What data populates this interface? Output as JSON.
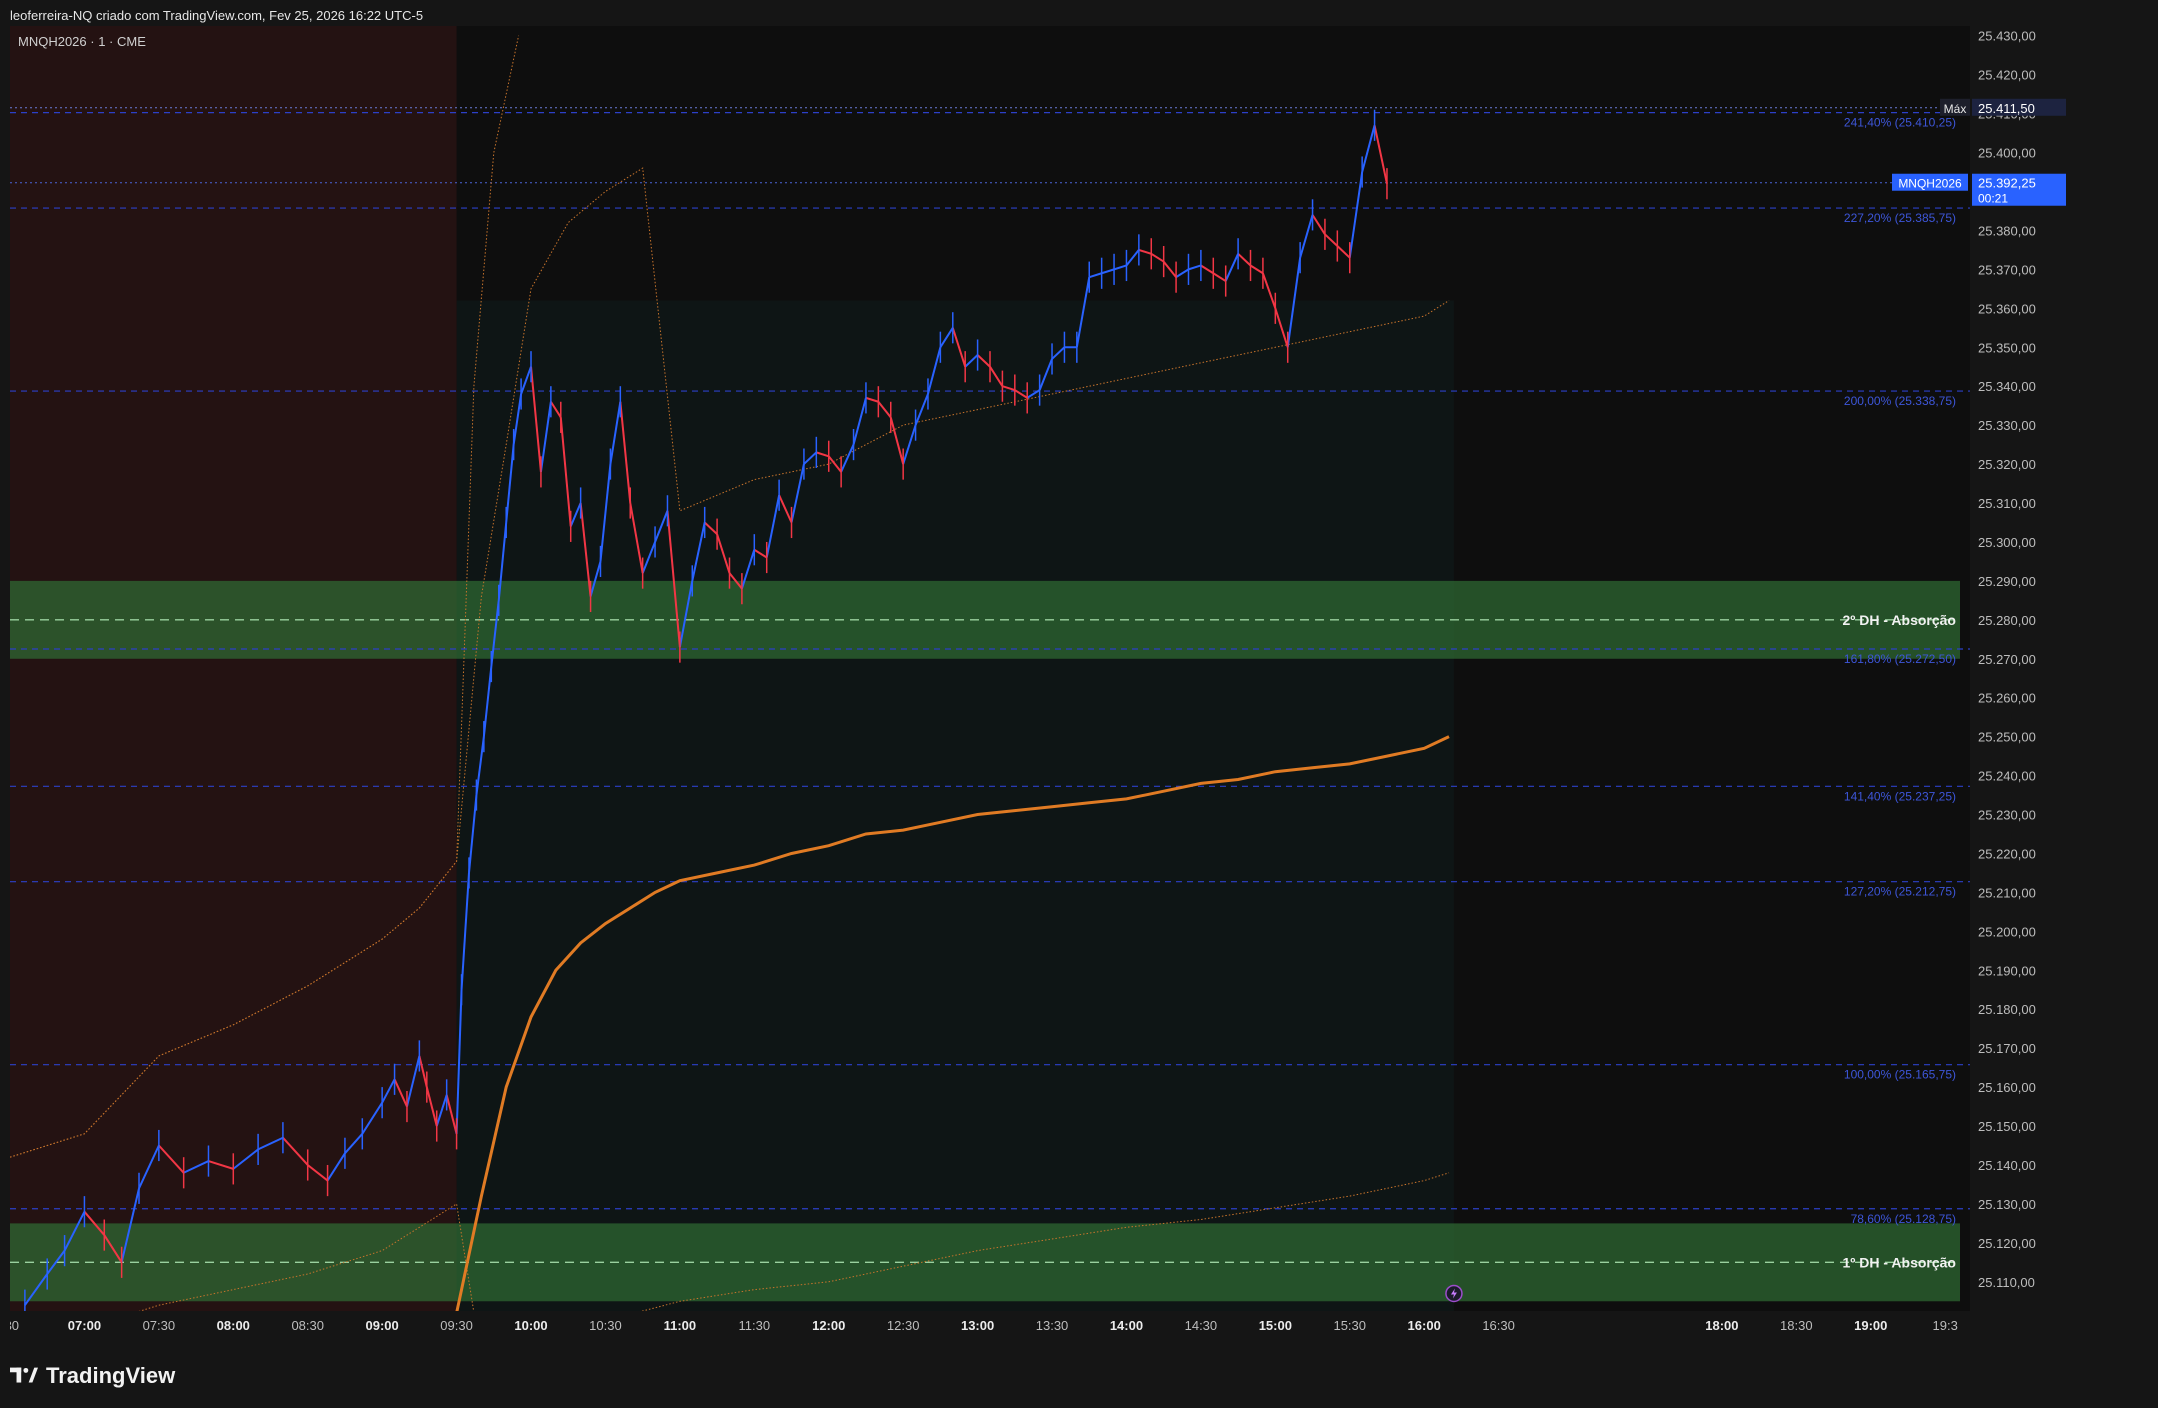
{
  "caption": "leoferreira-NQ criado com TradingView.com, Fev 25, 2026 16:22 UTC-5",
  "footer": {
    "brand": "TradingView"
  },
  "colors": {
    "bg": "#0e0e0e",
    "premarket": "#2b1414",
    "up": "#2962ff",
    "down": "#f23645",
    "vwap": "#e07b24",
    "band": "#c8742c",
    "zone": "#2f6b33",
    "fib": "#2c40c8",
    "price_tag": "#2962ff"
  },
  "chart_data": {
    "type": "line",
    "symbol": "MNQH2026 · 1 · CME",
    "ylim": [
      25102.5,
      25432.5
    ],
    "y_ticks": [
      "25.110,00",
      "25.120,00",
      "25.130,00",
      "25.140,00",
      "25.150,00",
      "25.160,00",
      "25.170,00",
      "25.180,00",
      "25.190,00",
      "25.200,00",
      "25.210,00",
      "25.220,00",
      "25.230,00",
      "25.240,00",
      "25.250,00",
      "25.260,00",
      "25.270,00",
      "25.280,00",
      "25.290,00",
      "25.300,00",
      "25.310,00",
      "25.320,00",
      "25.330,00",
      "25.340,00",
      "25.350,00",
      "25.360,00",
      "25.370,00",
      "25.380,00",
      "25.390,00",
      "25.400,00",
      "25.410,00",
      "25.420,00",
      "25.430,00"
    ],
    "y_tick_values": [
      25110,
      25120,
      25130,
      25140,
      25150,
      25160,
      25170,
      25180,
      25190,
      25200,
      25210,
      25220,
      25230,
      25240,
      25250,
      25260,
      25270,
      25280,
      25290,
      25300,
      25310,
      25320,
      25330,
      25340,
      25350,
      25360,
      25370,
      25380,
      25390,
      25400,
      25410,
      25420,
      25430
    ],
    "x_ticks": [
      {
        "label": ":30",
        "t": "06:30",
        "major": false
      },
      {
        "label": "07:00",
        "t": "07:00",
        "major": true
      },
      {
        "label": "07:30",
        "t": "07:30",
        "major": false
      },
      {
        "label": "08:00",
        "t": "08:00",
        "major": true
      },
      {
        "label": "08:30",
        "t": "08:30",
        "major": false
      },
      {
        "label": "09:00",
        "t": "09:00",
        "major": true
      },
      {
        "label": "09:30",
        "t": "09:30",
        "major": false
      },
      {
        "label": "10:00",
        "t": "10:00",
        "major": true
      },
      {
        "label": "10:30",
        "t": "10:30",
        "major": false
      },
      {
        "label": "11:00",
        "t": "11:00",
        "major": true
      },
      {
        "label": "11:30",
        "t": "11:30",
        "major": false
      },
      {
        "label": "12:00",
        "t": "12:00",
        "major": true
      },
      {
        "label": "12:30",
        "t": "12:30",
        "major": false
      },
      {
        "label": "13:00",
        "t": "13:00",
        "major": true
      },
      {
        "label": "13:30",
        "t": "13:30",
        "major": false
      },
      {
        "label": "14:00",
        "t": "14:00",
        "major": true
      },
      {
        "label": "14:30",
        "t": "14:30",
        "major": false
      },
      {
        "label": "15:00",
        "t": "15:00",
        "major": true
      },
      {
        "label": "15:30",
        "t": "15:30",
        "major": false
      },
      {
        "label": "16:00",
        "t": "16:00",
        "major": true
      },
      {
        "label": "16:30",
        "t": "16:30",
        "major": false
      },
      {
        "label": "18:00",
        "t": "18:00",
        "major": true
      },
      {
        "label": "18:30",
        "t": "18:30",
        "major": false
      },
      {
        "label": "19:00",
        "t": "19:00",
        "major": true
      },
      {
        "label": "19:3",
        "t": "19:30",
        "major": false
      }
    ],
    "series": [
      {
        "type": "price",
        "t": [
          "06:36",
          "06:45",
          "06:52",
          "07:00",
          "07:08",
          "07:15",
          "07:22",
          "07:30",
          "07:40",
          "07:50",
          "08:00",
          "08:10",
          "08:20",
          "08:30",
          "08:38",
          "08:45",
          "08:52",
          "09:00",
          "09:05",
          "09:10",
          "09:15",
          "09:18",
          "09:22",
          "09:26",
          "09:30",
          "09:32",
          "09:35",
          "09:38",
          "09:41",
          "09:44",
          "09:47",
          "09:50",
          "09:53",
          "09:56",
          "10:00",
          "10:04",
          "10:08",
          "10:12",
          "10:16",
          "10:20",
          "10:24",
          "10:28",
          "10:32",
          "10:36",
          "10:40",
          "10:45",
          "10:50",
          "10:55",
          "11:00",
          "11:05",
          "11:10",
          "11:15",
          "11:20",
          "11:25",
          "11:30",
          "11:35",
          "11:40",
          "11:45",
          "11:50",
          "11:55",
          "12:00",
          "12:05",
          "12:10",
          "12:15",
          "12:20",
          "12:25",
          "12:30",
          "12:35",
          "12:40",
          "12:45",
          "12:50",
          "12:55",
          "13:00",
          "13:05",
          "13:10",
          "13:15",
          "13:20",
          "13:25",
          "13:30",
          "13:35",
          "13:40",
          "13:45",
          "13:50",
          "13:55",
          "14:00",
          "14:05",
          "14:10",
          "14:15",
          "14:20",
          "14:25",
          "14:30",
          "14:35",
          "14:40",
          "14:45",
          "14:50",
          "14:55",
          "15:00",
          "15:05",
          "15:10",
          "15:15",
          "15:20",
          "15:25",
          "15:30",
          "15:35",
          "15:40",
          "15:45",
          "15:50",
          "15:55",
          "16:00",
          "16:04",
          "16:08",
          "16:12"
        ],
        "values": [
          25104,
          25112,
          25118,
          25128,
          25122,
          25115,
          25134,
          25145,
          25138,
          25141,
          25139,
          25144,
          25147,
          25140,
          25136,
          25143,
          25148,
          25156,
          25162,
          25155,
          25168,
          25160,
          25150,
          25158,
          25148,
          25185,
          25215,
          25235,
          25250,
          25268,
          25285,
          25305,
          25325,
          25338,
          25345,
          25318,
          25336,
          25332,
          25304,
          25310,
          25286,
          25295,
          25320,
          25336,
          25310,
          25292,
          25300,
          25308,
          25273,
          25290,
          25305,
          25302,
          25292,
          25288,
          25298,
          25296,
          25312,
          25305,
          25320,
          25323,
          25322,
          25318,
          25325,
          25337,
          25336,
          25332,
          25320,
          25330,
          25338,
          25350,
          25355,
          25345,
          25348,
          25345,
          25340,
          25339,
          25337,
          25339,
          25347,
          25350,
          25350,
          25368,
          25369,
          25370,
          25371,
          25375,
          25374,
          25372,
          25368,
          25370,
          25371,
          25369,
          25367,
          25374,
          25371,
          25369,
          25360,
          25350,
          25373,
          25384,
          25379,
          25376,
          25373,
          25395,
          25407,
          25392
        ]
      },
      {
        "type": "vwap",
        "t": [
          "09:30",
          "09:40",
          "09:50",
          "10:00",
          "10:10",
          "10:20",
          "10:30",
          "10:40",
          "10:50",
          "11:00",
          "11:15",
          "11:30",
          "11:45",
          "12:00",
          "12:15",
          "12:30",
          "12:45",
          "13:00",
          "13:15",
          "13:30",
          "13:45",
          "14:00",
          "14:15",
          "14:30",
          "14:45",
          "15:00",
          "15:15",
          "15:30",
          "15:45",
          "16:00",
          "16:10"
        ],
        "values": [
          25102,
          25132,
          25160,
          25178,
          25190,
          25197,
          25202,
          25206,
          25210,
          25213,
          25215,
          25217,
          25220,
          25222,
          25225,
          25226,
          25228,
          25230,
          25231,
          25232,
          25233,
          25234,
          25236,
          25238,
          25239,
          25241,
          25242,
          25243,
          25245,
          25247,
          25250
        ]
      },
      {
        "type": "upper_band",
        "t": [
          "06:30",
          "07:00",
          "07:30",
          "08:00",
          "08:30",
          "09:00",
          "09:15",
          "09:30",
          "09:40",
          "09:50",
          "10:00",
          "10:15",
          "10:30",
          "10:45",
          "11:00",
          "11:30",
          "12:00",
          "12:30",
          "13:00",
          "13:30",
          "14:00",
          "14:30",
          "15:00",
          "15:30",
          "16:00",
          "16:10"
        ],
        "values": [
          25142,
          25148,
          25168,
          25176,
          25186,
          25198,
          25206,
          25218,
          25286,
          25325,
          25365,
          25382,
          25390,
          25396,
          25308,
          25316,
          25320,
          25330,
          25334,
          25338,
          25342,
          25346,
          25350,
          25354,
          25358,
          25362
        ]
      },
      {
        "type": "lower_band",
        "t": [
          "06:30",
          "07:00",
          "07:30",
          "08:00",
          "08:30",
          "09:00",
          "09:15",
          "09:30",
          "09:45",
          "10:00",
          "10:30",
          "11:00",
          "11:30",
          "12:00",
          "12:30",
          "13:00",
          "13:30",
          "14:00",
          "14:30",
          "15:00",
          "15:30",
          "16:00",
          "16:10"
        ],
        "values": [
          25094,
          25098,
          25104,
          25108,
          25112,
          25118,
          25124,
          25130,
          25070,
          25090,
          25100,
          25105,
          25108,
          25110,
          25114,
          25118,
          25121,
          25124,
          25126,
          25129,
          25132,
          25136,
          25138
        ]
      },
      {
        "type": "upper_band_premarket",
        "t": [
          "06:30",
          "07:00",
          "07:30",
          "08:00",
          "08:30",
          "09:00",
          "09:15",
          "09:30",
          "09:37",
          "09:45",
          "09:55"
        ],
        "values": [
          25142,
          25148,
          25168,
          25176,
          25186,
          25198,
          25206,
          25218,
          25340,
          25400,
          25430
        ]
      }
    ],
    "fib_levels": [
      {
        "label": "241,40% (25.410,25)",
        "value": 25410.25
      },
      {
        "label": "227,20% (25.385,75)",
        "value": 25385.75
      },
      {
        "label": "200,00% (25.338,75)",
        "value": 25338.75
      },
      {
        "label": "161,80% (25.272,50)",
        "value": 25272.5
      },
      {
        "label": "141,40% (25.237,25)",
        "value": 25237.25
      },
      {
        "label": "127,20% (25.212,75)",
        "value": 25212.75
      },
      {
        "label": "100,00% (25.165,75)",
        "value": 25165.75
      },
      {
        "label": "78,60% (25.128,75)",
        "value": 25128.75
      }
    ],
    "zones": [
      {
        "label": "2º DH - Absorção",
        "low": 25270,
        "high": 25290,
        "mid": 25280
      },
      {
        "label": "1º DH - Absorção",
        "low": 25105,
        "high": 25125,
        "mid": 25115
      }
    ],
    "max_marker": {
      "label": "Máx",
      "value": 25411.5,
      "value_text": "25.411,50"
    },
    "last_price": {
      "symbol": "MNQH2026",
      "value": 25392.25,
      "value_text": "25.392,25",
      "countdown": "00:21"
    }
  }
}
